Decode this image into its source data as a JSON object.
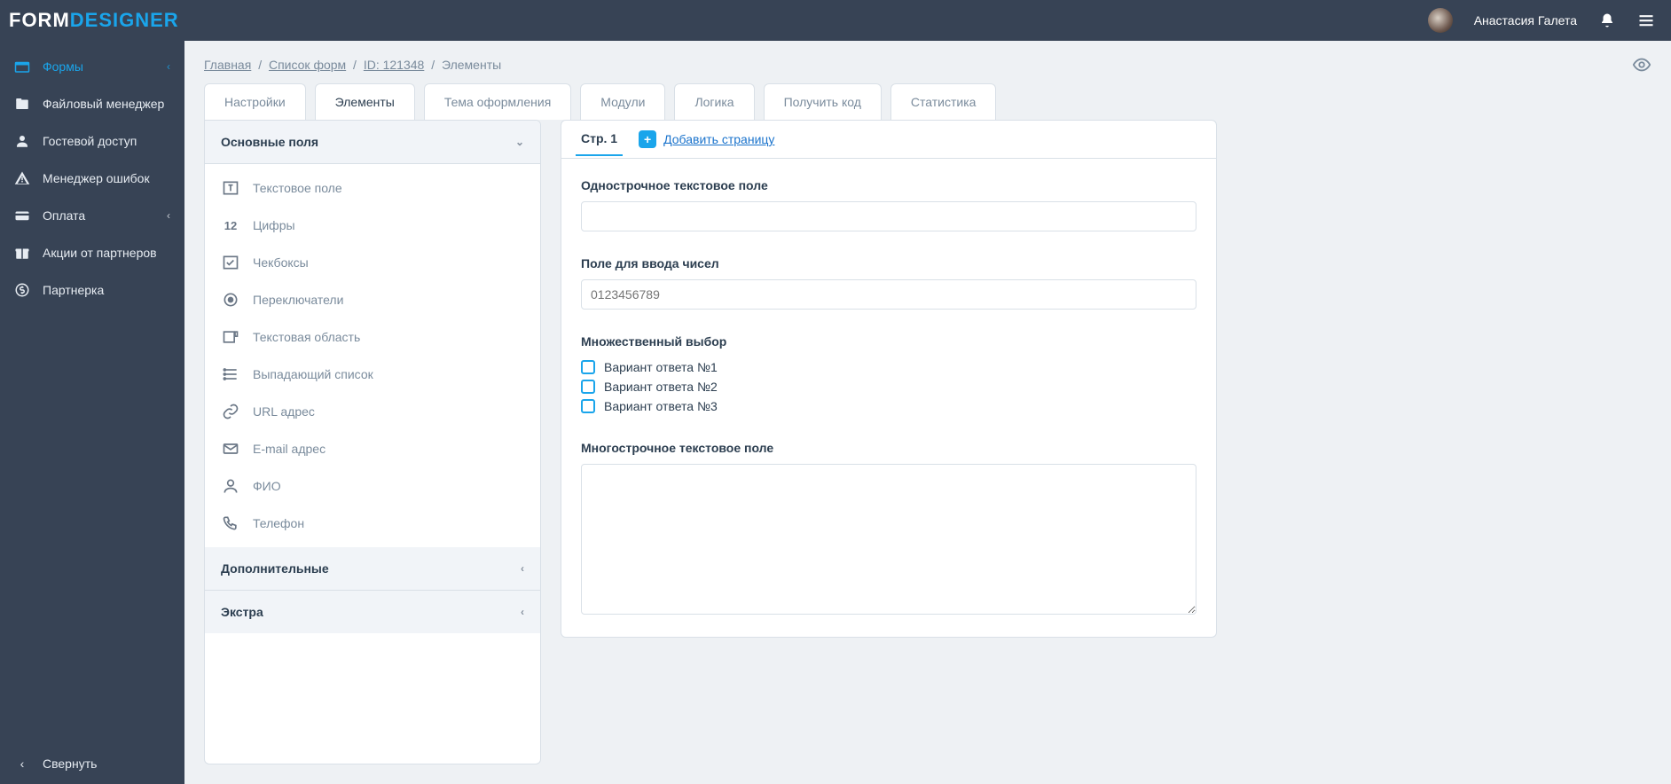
{
  "header": {
    "logo_a": "FORM",
    "logo_b": "DESIGNER",
    "username": "Анастасия Галета"
  },
  "sidebar": {
    "items": [
      {
        "label": "Формы",
        "icon": "forms-icon",
        "active": true,
        "has_chevron": true
      },
      {
        "label": "Файловый менеджер",
        "icon": "file-manager-icon"
      },
      {
        "label": "Гостевой доступ",
        "icon": "guest-access-icon"
      },
      {
        "label": "Менеджер ошибок",
        "icon": "error-manager-icon"
      },
      {
        "label": "Оплата",
        "icon": "payment-icon",
        "has_chevron": true
      },
      {
        "label": "Акции от партнеров",
        "icon": "promotions-icon"
      },
      {
        "label": "Партнерка",
        "icon": "affiliate-icon"
      }
    ],
    "collapse_label": "Свернуть"
  },
  "breadcrumb": {
    "home": "Главная",
    "forms_list": "Список форм",
    "form_id": "ID: 121348",
    "current": "Элементы"
  },
  "tabs": [
    {
      "label": "Настройки"
    },
    {
      "label": "Элементы",
      "active": true
    },
    {
      "label": "Тема оформления"
    },
    {
      "label": "Модули"
    },
    {
      "label": "Логика"
    },
    {
      "label": "Получить код"
    },
    {
      "label": "Статистика"
    }
  ],
  "palette": {
    "sections": {
      "basic": {
        "title": "Основные поля",
        "expanded": true
      },
      "additional": {
        "title": "Дополнительные",
        "expanded": false
      },
      "extra": {
        "title": "Экстра",
        "expanded": false
      }
    },
    "basic_items": [
      {
        "label": "Текстовое поле",
        "icon": "text-field-icon"
      },
      {
        "label": "Цифры",
        "icon": "number-field-icon",
        "text_icon": "12"
      },
      {
        "label": "Чекбоксы",
        "icon": "checkbox-field-icon"
      },
      {
        "label": "Переключатели",
        "icon": "radio-field-icon"
      },
      {
        "label": "Текстовая область",
        "icon": "textarea-field-icon"
      },
      {
        "label": "Выпадающий список",
        "icon": "select-field-icon"
      },
      {
        "label": "URL адрес",
        "icon": "url-field-icon"
      },
      {
        "label": "E-mail адрес",
        "icon": "email-field-icon"
      },
      {
        "label": "ФИО",
        "icon": "name-field-icon"
      },
      {
        "label": "Телефон",
        "icon": "phone-field-icon"
      }
    ]
  },
  "canvas": {
    "page_tab": "Стр. 1",
    "add_page": "Добавить страницу",
    "fields": {
      "text": {
        "label": "Однострочное текстовое поле",
        "value": ""
      },
      "number": {
        "label": "Поле для ввода чисел",
        "placeholder": "0123456789"
      },
      "checkboxes": {
        "label": "Множественный выбор",
        "options": [
          "Вариант ответа №1",
          "Вариант ответа №2",
          "Вариант ответа №3"
        ]
      },
      "textarea": {
        "label": "Многострочное текстовое поле",
        "value": ""
      }
    }
  }
}
